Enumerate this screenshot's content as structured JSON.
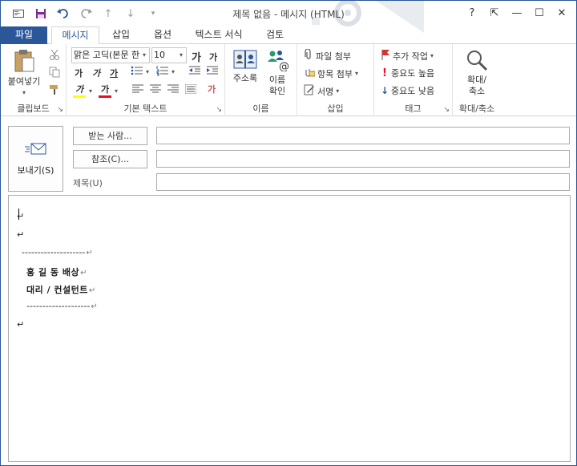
{
  "window": {
    "title": "제목 없음 - 메시지 (HTML)",
    "help": "?",
    "minimize": "—",
    "maximize": "☐",
    "close": "✕",
    "restore_ribbon": "⇱"
  },
  "quick_access": {
    "icons": [
      "mail-icon",
      "save-icon",
      "undo-icon",
      "redo-icon",
      "up-icon",
      "down-icon",
      "customize-icon"
    ]
  },
  "tabs": [
    {
      "label": "파일"
    },
    {
      "label": "메시지"
    },
    {
      "label": "삽입"
    },
    {
      "label": "옵션"
    },
    {
      "label": "텍스트 서식"
    },
    {
      "label": "검토"
    }
  ],
  "ribbon": {
    "clipboard": {
      "paste_label": "붙여넣기",
      "group_label": "클립보드"
    },
    "basic_text": {
      "font_name": "맑은 고딕(본문 한",
      "font_size": "10",
      "grow": "가",
      "shrink": "가",
      "bold": "가",
      "italic": "가",
      "underline": "가",
      "highlight": "가",
      "font_color": "가",
      "clear": "가",
      "group_label": "기본 텍스트"
    },
    "names": {
      "address_book": "주소록",
      "check_names_1": "이름",
      "check_names_2": "확인",
      "group_label": "이름"
    },
    "include": {
      "attach_file": "파일 첨부",
      "attach_item": "항목 첨부",
      "signature": "서명",
      "group_label": "삽입"
    },
    "tags": {
      "follow_up": "추가 작업",
      "high_importance": "중요도 높음",
      "low_importance": "중요도 낮음",
      "group_label": "태그"
    },
    "zoom": {
      "zoom_1": "확대/",
      "zoom_2": "축소",
      "group_label": "확대/축소"
    }
  },
  "header": {
    "send_label": "보내기(S)",
    "to_button": "받는 사람...",
    "cc_button": "참조(C)...",
    "subject_label": "제목(U)",
    "to_value": "",
    "cc_value": "",
    "subject_value": ""
  },
  "body": {
    "mark": "↵",
    "signature_lines": [
      "--------------------",
      "홍 길 동 배상",
      "대리 / 컨설턴트",
      "--------------------"
    ]
  },
  "colors": {
    "accent": "#2b579a",
    "highlight": "#ffff00",
    "font_red": "#e81123",
    "flag_red": "#d13438"
  }
}
